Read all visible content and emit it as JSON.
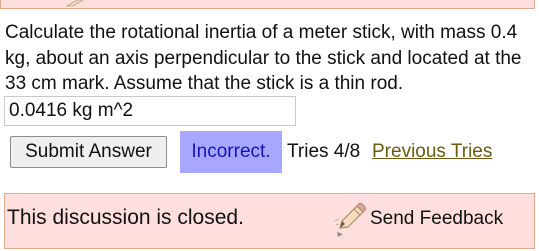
{
  "question": {
    "text": "Calculate the rotational inertia of a meter stick, with mass 0.4  kg, about an axis perpendicular to the stick and located at the 33  cm mark. Assume that the stick is a thin rod."
  },
  "answer": {
    "value": "0.0416 kg m^2"
  },
  "actions": {
    "submit_label": "Submit Answer",
    "result_label": "Incorrect.",
    "tries_label": "Tries 4/8",
    "previous_tries_label": "Previous Tries"
  },
  "discussion": {
    "closed_text": "This discussion is closed.",
    "feedback_label": "Send Feedback"
  },
  "colors": {
    "panel_bg": "#ffdede",
    "panel_border": "#e0a98a",
    "incorrect_bg": "#a7a7ff",
    "incorrect_text": "#1515b5",
    "link_color": "#6a5a12"
  },
  "icons": {
    "top": "pencil-icon",
    "feedback": "feedback-pencil-icon"
  }
}
